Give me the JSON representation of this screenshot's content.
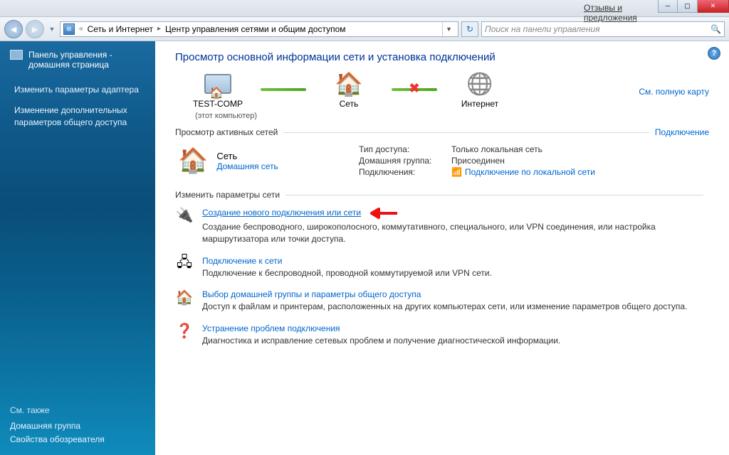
{
  "titlebar": {
    "feedback": "Отзывы и предложения"
  },
  "toolbar": {
    "breadcrumb": {
      "part1": "Сеть и Интернет",
      "part2": "Центр управления сетями и общим доступом"
    },
    "search_placeholder": "Поиск на панели управления"
  },
  "sidebar": {
    "home_line1": "Панель управления -",
    "home_line2": "домашняя страница",
    "task1": "Изменить параметры адаптера",
    "task2": "Изменение дополнительных параметров общего доступа",
    "see_also_hdr": "См. также",
    "see_also_1": "Домашняя группа",
    "see_also_2": "Свойства обозревателя"
  },
  "content": {
    "title": "Просмотр основной информации сети и установка подключений",
    "full_map": "См. полную карту",
    "node_pc_name": "TEST-COMP",
    "node_pc_sub": "(этот компьютер)",
    "node_net": "Сеть",
    "node_inet": "Интернет",
    "active_hdr": "Просмотр активных сетей",
    "active_link": "Подключение",
    "net_name": "Сеть",
    "net_type_link": "Домашняя сеть",
    "prop_access_label": "Тип доступа:",
    "prop_access_val": "Только локальная сеть",
    "prop_hg_label": "Домашняя группа:",
    "prop_hg_val": "Присоединен",
    "prop_conn_label": "Подключения:",
    "prop_conn_val": "Подключение по локальной сети",
    "change_hdr": "Изменить параметры сети",
    "task1_title": "Создание нового подключения или сети",
    "task1_desc": "Создание беспроводного, широкополосного, коммутативного, специального, или VPN соединения, или настройка маршрутизатора или точки доступа.",
    "task2_title": "Подключение к сети",
    "task2_desc": "Подключение к беспроводной, проводной коммутируемой или VPN сети.",
    "task3_title": "Выбор домашней группы и параметры общего доступа",
    "task3_desc": "Доступ к файлам и принтерам, расположенных на других компьютерах сети, или изменение параметров общего доступа.",
    "task4_title": "Устранение проблем подключения",
    "task4_desc": "Диагностика и исправление сетевых проблем и получение диагностической информации."
  }
}
